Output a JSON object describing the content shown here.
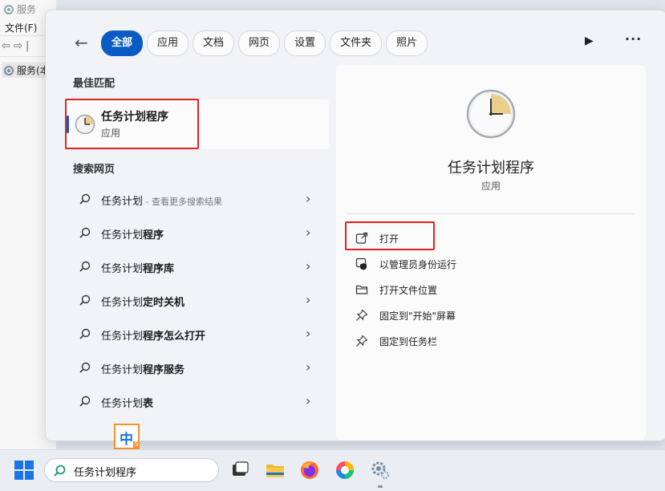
{
  "bg_window": {
    "title": "服务",
    "menu_file": "文件(F)",
    "nav_arrows": "⇦ ⇨ |",
    "tree_item": "服务(本"
  },
  "filters": [
    "全部",
    "应用",
    "文档",
    "网页",
    "设置",
    "文件夹",
    "照片"
  ],
  "sections": {
    "best_match": "最佳匹配",
    "search_web": "搜索网页"
  },
  "best_match": {
    "name": "任务计划程序",
    "type": "应用"
  },
  "web_results": [
    {
      "prefix": "任务计划",
      "bold": "",
      "sub": " - 查看更多搜索结果"
    },
    {
      "prefix": "任务计划",
      "bold": "程序",
      "sub": ""
    },
    {
      "prefix": "任务计划",
      "bold": "程序库",
      "sub": ""
    },
    {
      "prefix": "任务计划",
      "bold": "定时关机",
      "sub": ""
    },
    {
      "prefix": "任务计划",
      "bold": "程序怎么打开",
      "sub": ""
    },
    {
      "prefix": "任务计划",
      "bold": "程序服务",
      "sub": ""
    },
    {
      "prefix": "任务计划",
      "bold": "表",
      "sub": ""
    }
  ],
  "detail": {
    "title": "任务计划程序",
    "type": "应用",
    "actions": [
      {
        "label": "打开",
        "icon": "open-external-icon"
      },
      {
        "label": "以管理员身份运行",
        "icon": "shield-icon"
      },
      {
        "label": "打开文件位置",
        "icon": "folder-icon"
      },
      {
        "label": "固定到\"开始\"屏幕",
        "icon": "pin-icon"
      },
      {
        "label": "固定到任务栏",
        "icon": "pin-icon"
      }
    ]
  },
  "ime": {
    "label": "中",
    "badge": "S"
  },
  "taskbar": {
    "search_value": "任务计划程序"
  },
  "colors": {
    "accent": "#0a5cc4",
    "highlight": "#e0231d"
  }
}
